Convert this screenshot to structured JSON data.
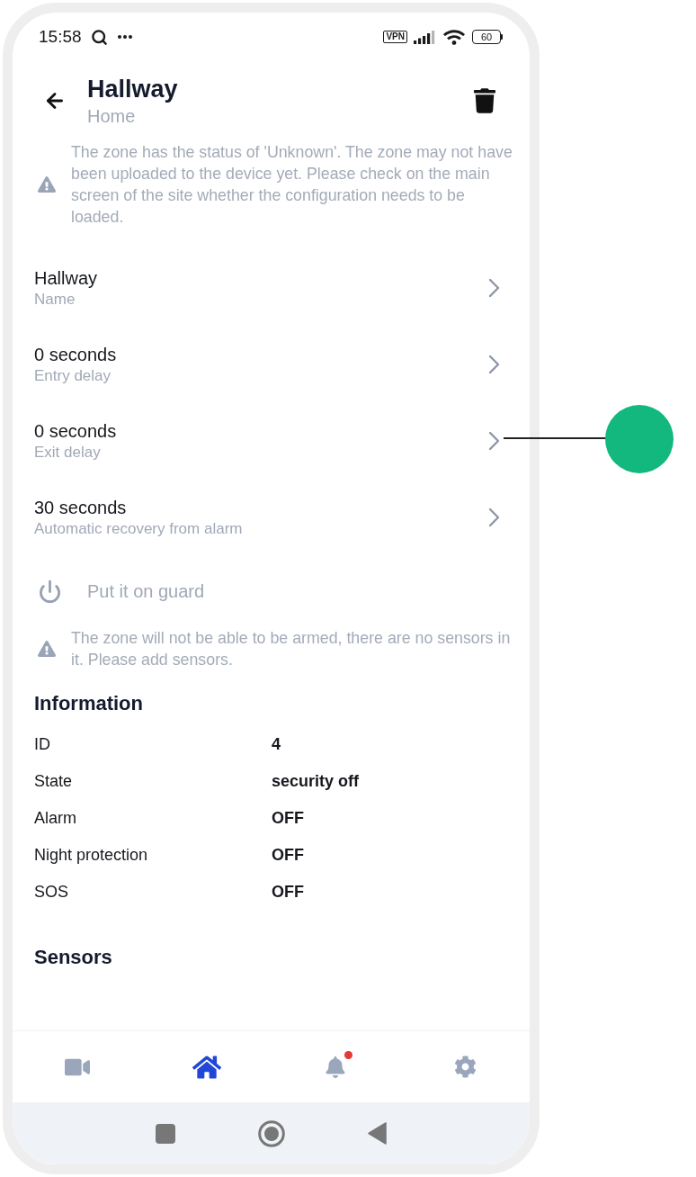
{
  "status_bar": {
    "time": "15:58",
    "vpn": "VPN",
    "battery": "60"
  },
  "header": {
    "title": "Hallway",
    "subtitle": "Home"
  },
  "zone_warning": "The zone has the status of 'Unknown'. The zone may not have been uploaded to the device yet. Please check on the main screen of the site whether the configuration needs to be loaded.",
  "settings": [
    {
      "value": "Hallway",
      "label": "Name"
    },
    {
      "value": "0 seconds",
      "label": "Entry delay"
    },
    {
      "value": "0 seconds",
      "label": "Exit delay"
    },
    {
      "value": "30 seconds",
      "label": "Automatic recovery from alarm"
    }
  ],
  "guard_button": {
    "label": "Put it on guard",
    "disabled": true
  },
  "arm_warning": "The zone will not be able to be armed, there are no sensors in it. Please add sensors.",
  "information": {
    "title": "Information",
    "rows": [
      {
        "label": "ID",
        "value": "4"
      },
      {
        "label": "State",
        "value": "security off"
      },
      {
        "label": "Alarm",
        "value": "OFF"
      },
      {
        "label": "Night protection",
        "value": "OFF"
      },
      {
        "label": "SOS",
        "value": "OFF"
      }
    ]
  },
  "sensors": {
    "title": "Sensors"
  },
  "bottom_nav": [
    {
      "kind": "cameras",
      "selected": false,
      "badge": false
    },
    {
      "kind": "home",
      "selected": true,
      "badge": false
    },
    {
      "kind": "notifications",
      "selected": false,
      "badge": true
    },
    {
      "kind": "settings",
      "selected": false,
      "badge": false
    }
  ]
}
